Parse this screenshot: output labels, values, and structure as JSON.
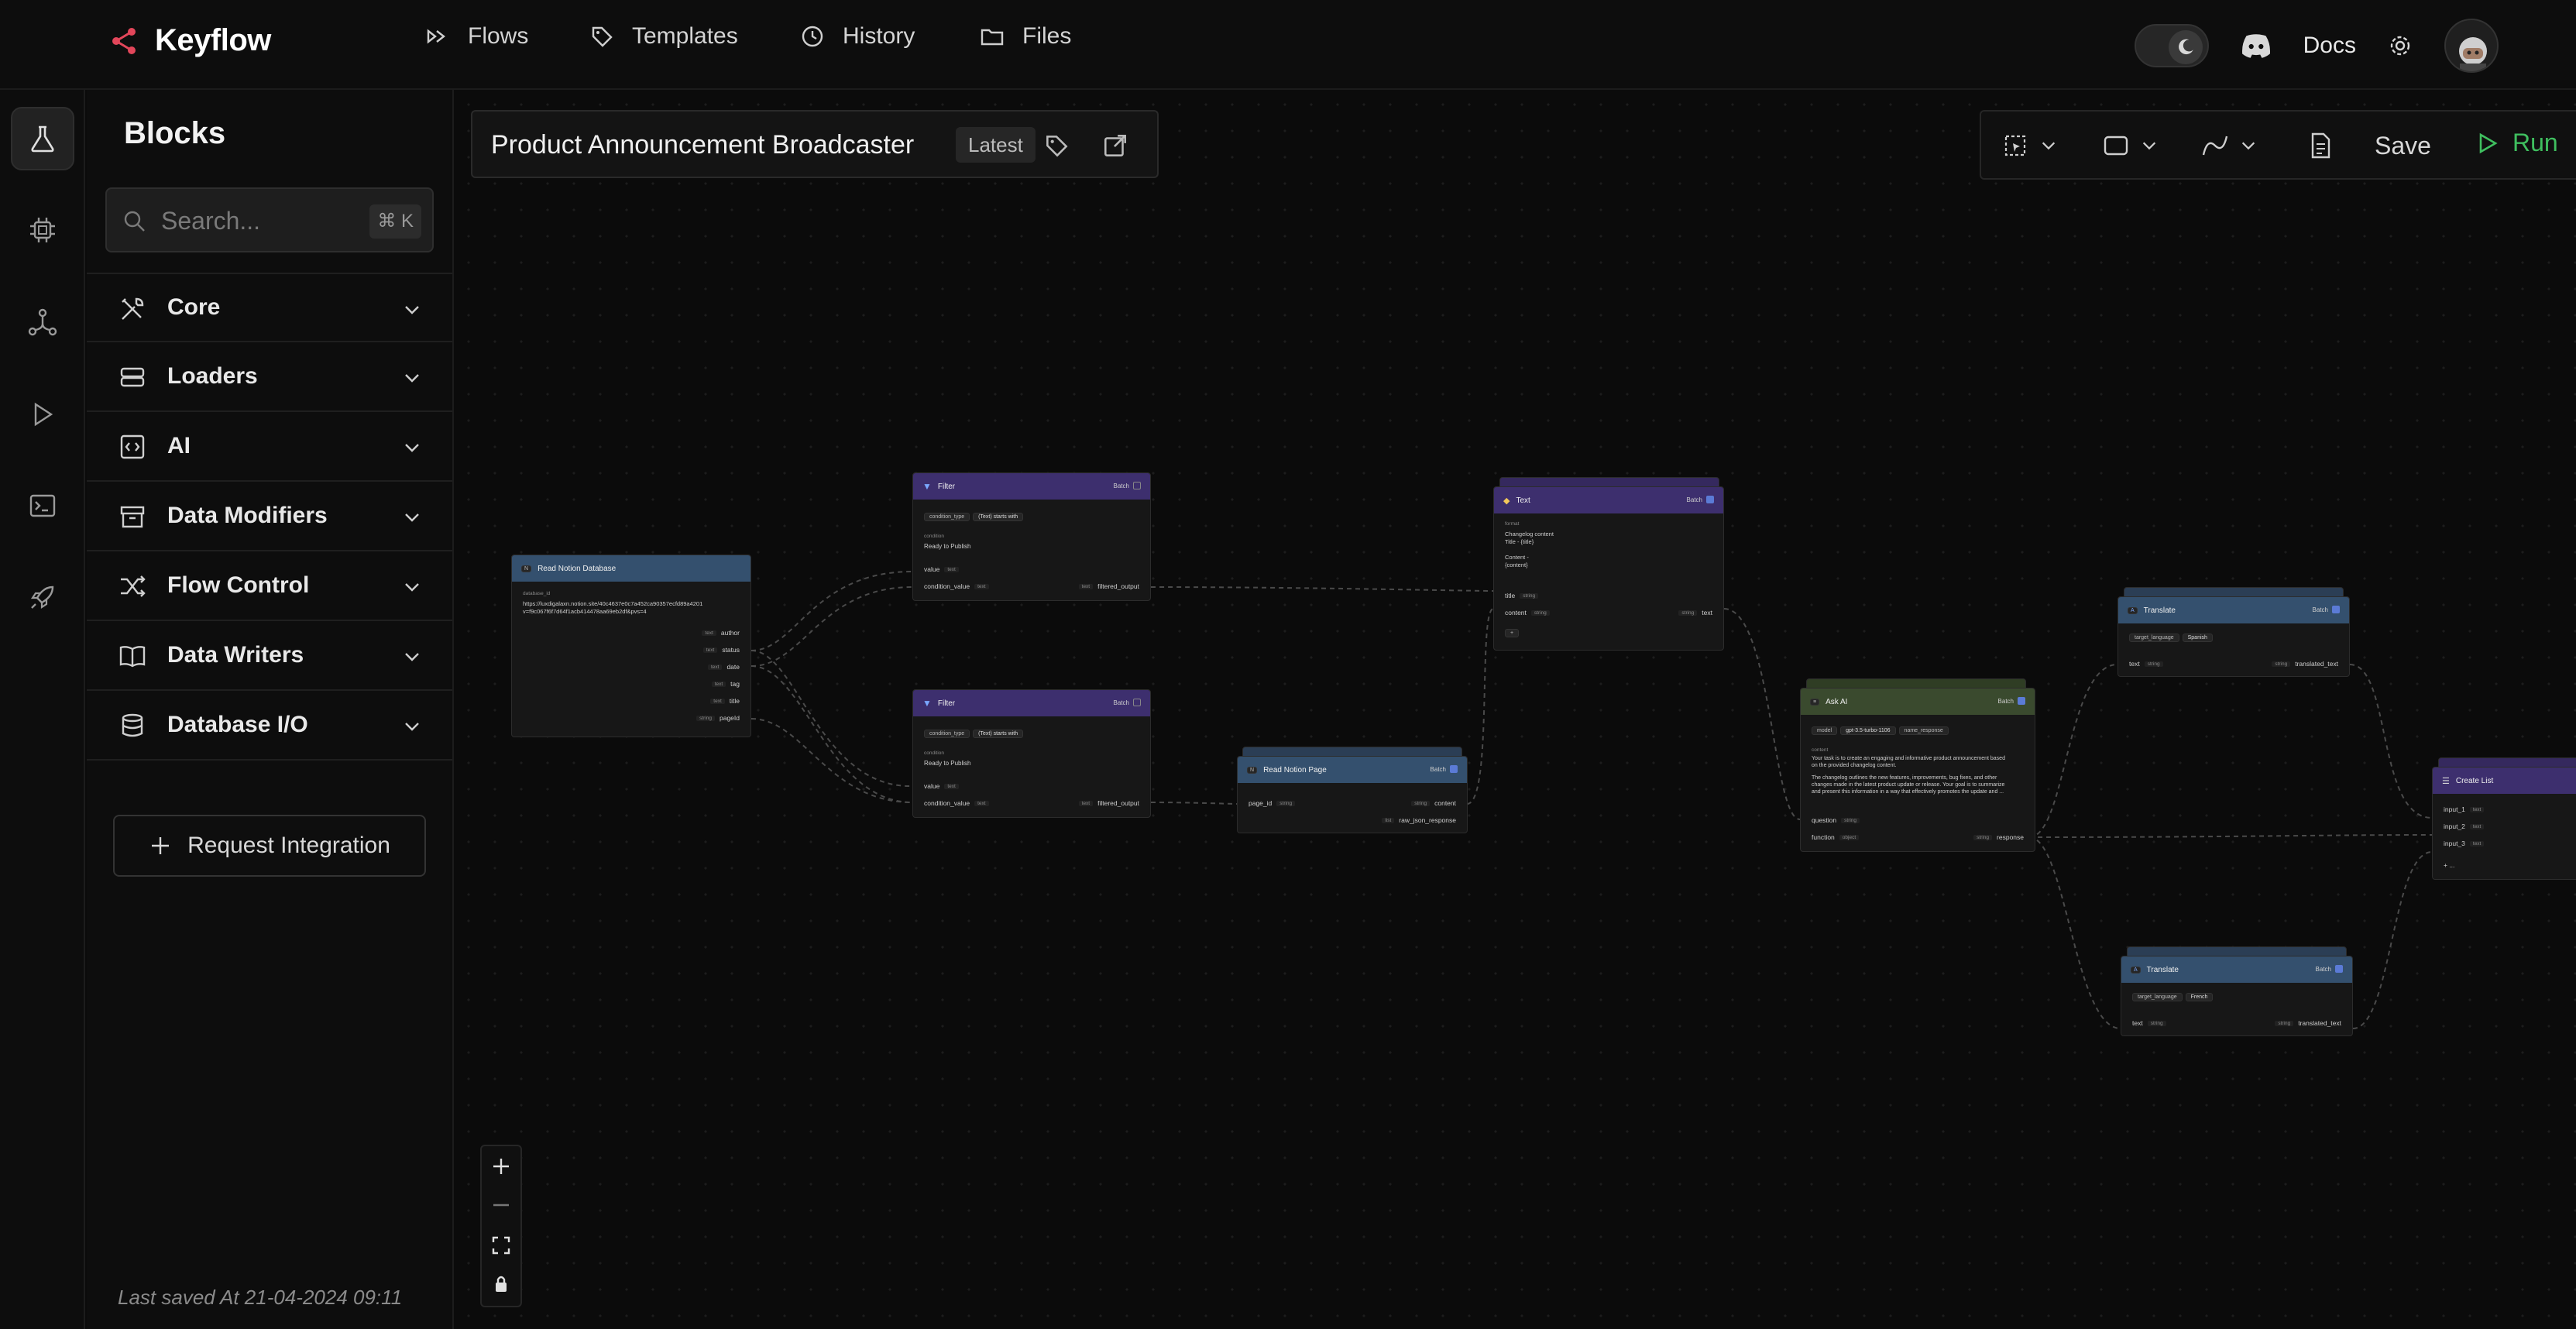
{
  "app": {
    "name": "Keyflow"
  },
  "nav": [
    {
      "label": "Flows",
      "icon": "flows-icon"
    },
    {
      "label": "Templates",
      "icon": "tag-icon"
    },
    {
      "label": "History",
      "icon": "clock-icon"
    },
    {
      "label": "Files",
      "icon": "folder-icon"
    }
  ],
  "header_right": {
    "docs": "Docs"
  },
  "blocks_panel": {
    "title": "Blocks",
    "search_placeholder": "Search...",
    "search_shortcut": "⌘ K",
    "categories": [
      "Core",
      "Loaders",
      "AI",
      "Data Modifiers",
      "Flow Control",
      "Data Writers",
      "Database I/O"
    ],
    "request_integration": "Request Integration",
    "last_saved": "Last saved At 21-04-2024 09:11"
  },
  "flow": {
    "title": "Product Announcement Broadcaster",
    "version": "Latest"
  },
  "toolbar": {
    "save": "Save",
    "run": "Run"
  },
  "nodes": {
    "read_notion_db": {
      "title": "Read Notion Database",
      "param_label": "database_id",
      "param_value": "https://luxdigalaxn.notion.site/40c4637e0c7a452ca90357ecfd89a4201",
      "param_value2": "v=f9c067f6f7d64f1acb414478aa69eb2df&pvs=4",
      "outputs": [
        "author",
        "status",
        "date",
        "tag",
        "title",
        "pageId"
      ],
      "output_types": [
        "text",
        "text",
        "text",
        "text",
        "text",
        "string"
      ]
    },
    "filter1": {
      "title": "Filter",
      "batch": "Batch",
      "condition_type_label": "condition_type",
      "condition_type_value": "(Text) starts with",
      "condition_label": "condition",
      "condition_value": "Ready to Publish",
      "inputs": [
        "value",
        "condition_value"
      ],
      "output": "filtered_output",
      "type_text": "text"
    },
    "filter2": {
      "title": "Filter",
      "batch": "Batch",
      "condition_type_label": "condition_type",
      "condition_type_value": "(Text) starts with",
      "condition_label": "condition",
      "condition_value": "Ready to Publish",
      "inputs": [
        "value",
        "condition_value"
      ],
      "output": "filtered_output",
      "type_text": "text"
    },
    "read_notion_page": {
      "title": "Read Notion Page",
      "batch": "Batch",
      "input": "page_id",
      "input_type": "string",
      "outputs": [
        "content",
        "raw_json_response"
      ],
      "output_types": [
        "string",
        "list"
      ]
    },
    "text": {
      "title": "Text",
      "batch": "Batch",
      "body_label": "format",
      "body_lines": [
        "Changelog content",
        "Title - {title}",
        "",
        "Content -",
        "{content}"
      ],
      "inputs": [
        "title",
        "content"
      ],
      "input_type": "string",
      "output": "text",
      "output_type": "string"
    },
    "ask_ai": {
      "title": "Ask AI",
      "batch": "Batch",
      "model_label": "model",
      "model_value": "gpt-3.5-turbo-1106",
      "name_response": "name_response",
      "content_label": "content",
      "content_lines": [
        "Your task is to create an engaging and informative product announcement based",
        "on the provided changelog content.",
        "",
        "The changelog outlines the new features, improvements, bug fixes, and other",
        "changes made in the latest product update or release. Your goal is to summarize",
        "and present this information in a way that effectively promotes the update and ..."
      ],
      "inputs": [
        "question",
        "function"
      ],
      "input_types": [
        "string",
        "object"
      ],
      "output": "response",
      "output_type": "string"
    },
    "translate1": {
      "title": "Translate",
      "batch": "Batch",
      "lang_label": "target_language",
      "lang_value": "Spanish",
      "input": "text",
      "input_type": "string",
      "output": "translated_text",
      "output_type": "string"
    },
    "translate2": {
      "title": "Translate",
      "batch": "Batch",
      "lang_label": "target_language",
      "lang_value": "French",
      "input": "text",
      "input_type": "string",
      "output": "translated_text",
      "output_type": "string"
    },
    "create_list": {
      "title": "Create List",
      "inputs": [
        "input_1",
        "input_2",
        "input_3"
      ],
      "input_type": "text",
      "add": "+ ..."
    }
  },
  "colors": {
    "header_blue": "#34506e",
    "header_purple": "#3d2f6e",
    "header_green": "#3a4a2e",
    "run_green": "#3fbf5f",
    "logo_red": "#e2465a"
  }
}
